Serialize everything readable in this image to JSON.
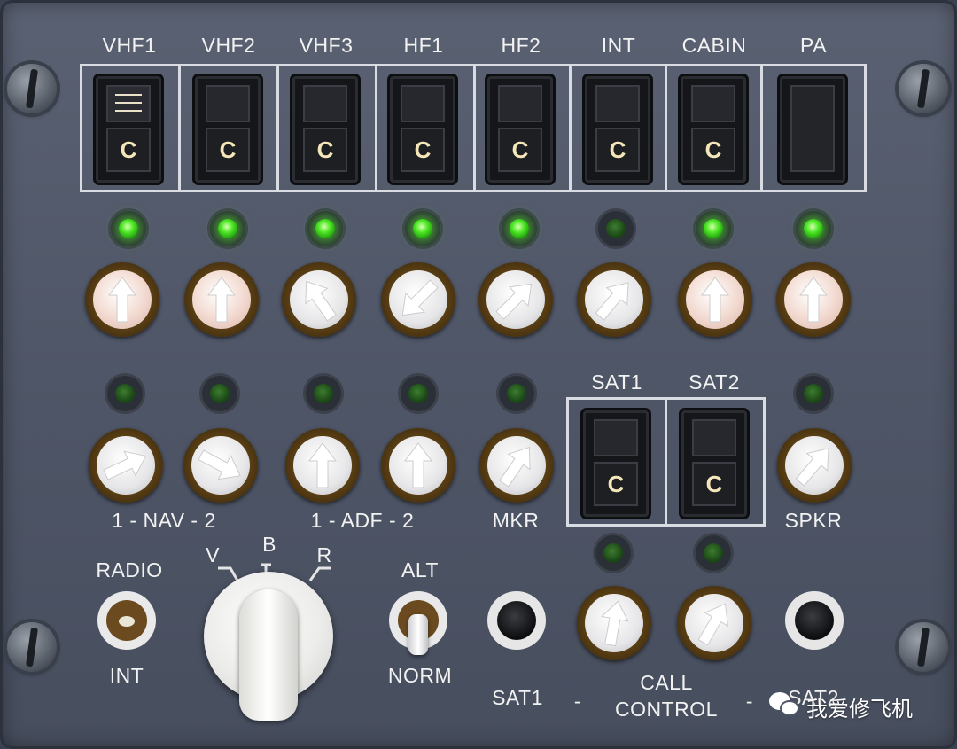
{
  "top_row": {
    "selectors": [
      {
        "label": "VHF1",
        "call": "C",
        "bars": true,
        "led": "on",
        "knob_lit": true
      },
      {
        "label": "VHF2",
        "call": "C",
        "bars": false,
        "led": "on",
        "knob_lit": true
      },
      {
        "label": "VHF3",
        "call": "C",
        "bars": false,
        "led": "on",
        "knob_lit": false
      },
      {
        "label": "HF1",
        "call": "C",
        "bars": false,
        "led": "on",
        "knob_lit": false
      },
      {
        "label": "HF2",
        "call": "C",
        "bars": false,
        "led": "on",
        "knob_lit": false
      },
      {
        "label": "INT",
        "call": "C",
        "bars": false,
        "led": "off",
        "knob_lit": false
      },
      {
        "label": "CABIN",
        "call": "C",
        "bars": false,
        "led": "on",
        "knob_lit": true
      },
      {
        "label": "PA",
        "call": "",
        "bars": false,
        "led": "on",
        "knob_lit": true
      }
    ]
  },
  "nav_row": {
    "nav_label": "1 - NAV - 2",
    "adf_label": "1 - ADF - 2",
    "mkr_label": "MKR",
    "spkr_label": "SPKR",
    "sat_selectors": [
      {
        "label": "SAT1",
        "call": "C"
      },
      {
        "label": "SAT2",
        "call": "C"
      }
    ]
  },
  "bottom_row": {
    "radio_label": "RADIO",
    "int_label": "INT",
    "filter_labels": {
      "v": "V",
      "b": "B",
      "r": "R"
    },
    "alt_label": "ALT",
    "norm_label": "NORM",
    "sat1_label": "SAT1",
    "dash_left": "-",
    "call_label": "CALL",
    "control_label": "CONTROL",
    "dash_right": "-",
    "sat2_label": "SAT2"
  },
  "watermark": {
    "text": "我爱修飞机",
    "icon": "wechat-icon"
  },
  "colors": {
    "led_on": "#53ea2a",
    "led_off": "#1c4a17",
    "panel": "#4f5667",
    "label": "#f2f2f2"
  }
}
